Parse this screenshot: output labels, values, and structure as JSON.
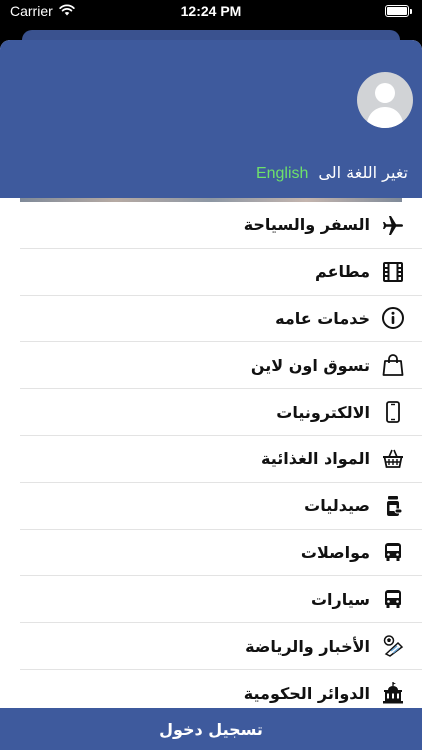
{
  "status_bar": {
    "carrier": "Carrier",
    "time": "12:24 PM"
  },
  "header": {
    "language_label": "تغير اللغة الى",
    "language_link": "English",
    "colors": {
      "background": "#3e5a9d",
      "link": "#6ee06b"
    }
  },
  "menu": {
    "items": [
      {
        "label": "السفر والسياحة",
        "icon": "airplane-icon"
      },
      {
        "label": "مطاعم",
        "icon": "film-icon"
      },
      {
        "label": "خدمات عامه",
        "icon": "info-icon"
      },
      {
        "label": "تسوق اون لاين",
        "icon": "shopping-bag-icon"
      },
      {
        "label": "الالكترونيات",
        "icon": "phone-icon"
      },
      {
        "label": "المواد الغذائية",
        "icon": "basket-icon"
      },
      {
        "label": "صيدليات",
        "icon": "pill-bottle-icon"
      },
      {
        "label": "مواصلات",
        "icon": "bus-icon"
      },
      {
        "label": "سيارات",
        "icon": "bus-icon"
      },
      {
        "label": "الأخبار والرياضة",
        "icon": "news-sports-icon"
      },
      {
        "label": "الدوائر الحكومية",
        "icon": "government-building-icon"
      }
    ]
  },
  "footer": {
    "login_label": "تسجيل دخول"
  }
}
